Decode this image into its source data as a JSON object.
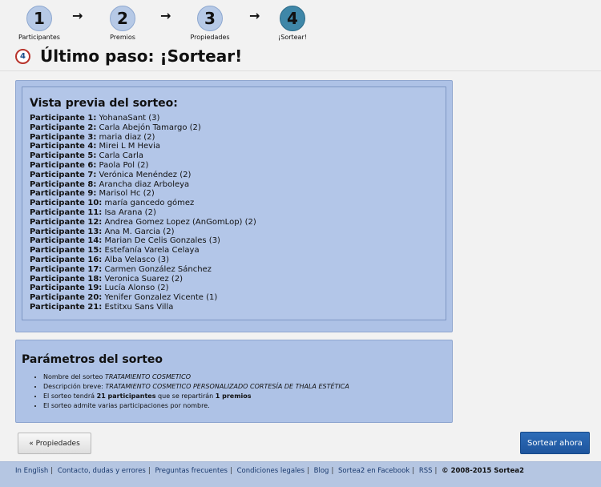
{
  "steps": [
    {
      "number": "1",
      "label": "Participantes"
    },
    {
      "number": "2",
      "label": "Premios"
    },
    {
      "number": "3",
      "label": "Propiedades"
    },
    {
      "number": "4",
      "label": "¡Sortear!"
    }
  ],
  "arrow_glyph": "→",
  "title": {
    "badge": "4",
    "text": "Último paso: ¡Sortear!"
  },
  "preview": {
    "title": "Vista previa del sorteo:",
    "participants": [
      {
        "label": "Participante 1:",
        "value": "YohanaSant (3)"
      },
      {
        "label": "Participante 2:",
        "value": "Carla Abejón Tamargo (2)"
      },
      {
        "label": "Participante 3:",
        "value": "maria diaz (2)"
      },
      {
        "label": "Participante 4:",
        "value": "Mirei L M Hevia"
      },
      {
        "label": "Participante 5:",
        "value": "Carla Carla"
      },
      {
        "label": "Participante 6:",
        "value": "Paola Pol (2)"
      },
      {
        "label": "Participante 7:",
        "value": "Verónica Menéndez (2)"
      },
      {
        "label": "Participante 8:",
        "value": "Arancha diaz Arboleya"
      },
      {
        "label": "Participante 9:",
        "value": "Marisol Hc (2)"
      },
      {
        "label": "Participante 10:",
        "value": "maría gancedo gómez"
      },
      {
        "label": "Participante 11:",
        "value": "Isa Arana (2)"
      },
      {
        "label": "Participante 12:",
        "value": "Andrea Gomez Lopez (AnGomLop) (2)"
      },
      {
        "label": "Participante 13:",
        "value": "Ana M. Garcia (2)"
      },
      {
        "label": "Participante 14:",
        "value": "Marian De Celis Gonzales (3)"
      },
      {
        "label": "Participante 15:",
        "value": "Estefanía Varela Celaya"
      },
      {
        "label": "Participante 16:",
        "value": "Alba Velasco (3)"
      },
      {
        "label": "Participante 17:",
        "value": "Carmen González Sánchez"
      },
      {
        "label": "Participante 18:",
        "value": "Veronica Suarez (2)"
      },
      {
        "label": "Participante 19:",
        "value": "Lucía Alonso (2)"
      },
      {
        "label": "Participante 20:",
        "value": "Yenifer Gonzalez Vicente (1)"
      },
      {
        "label": "Participante 21:",
        "value": "Estitxu Sans Villa"
      }
    ]
  },
  "params": {
    "title": "Parámetros del sorteo",
    "name_label": "Nombre del sorteo",
    "name_value": "TRATAMIENTO COSMETICO",
    "desc_label": "Descripción breve:",
    "desc_value": "TRATAMIENTO COSMETICO PERSONALIZADO CORTESÍA DE THALA ESTÉTICA",
    "count_prefix": "El sorteo tendrá",
    "count_participants": "21 participantes",
    "count_middle": "que se repartirán",
    "count_prizes": "1 premios",
    "multi_note": "El sorteo admite varias participaciones por nombre."
  },
  "buttons": {
    "back": "« Propiedades",
    "go": "Sortear ahora"
  },
  "footer": {
    "links": [
      "In English",
      "Contacto, dudas y errores",
      "Preguntas frecuentes",
      "Condiciones legales",
      "Blog",
      "Sortea2 en Facebook",
      "RSS"
    ],
    "separator": "|",
    "copyright": "© 2008-2015 Sortea2"
  },
  "colors": {
    "step_inactive": "#b6c9e6",
    "step_active": "#3f87a8",
    "panel_bg": "#aec2e6",
    "primary_button": "#1e559e",
    "footer_bg": "#b5c6e2"
  }
}
